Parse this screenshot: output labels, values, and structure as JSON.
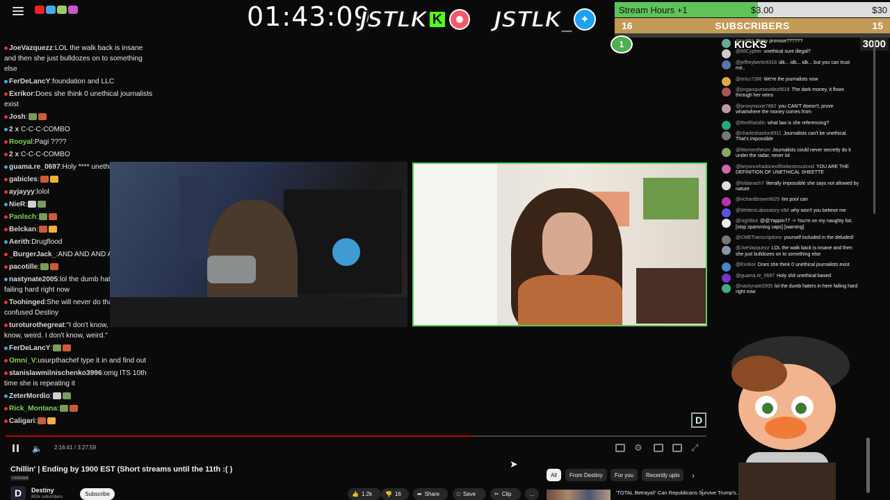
{
  "stream": {
    "timer": "01:43:09",
    "brand_left": "JSTLK",
    "brand_kick": "K",
    "brand_right": "JSTLK_",
    "stream_hours_label": "Stream Hours +1",
    "stream_hours_mid": "$3.00",
    "stream_hours_right": "$30",
    "subs_left": "16",
    "subs_title": "SUBSCRIBERS",
    "subs_right": "15",
    "kicks_badge": "1",
    "kicks_label": "KICKS",
    "kicks_value": "3000",
    "progress_fraction": 0.1,
    "accent": "#58d05a"
  },
  "left_chat": [
    {
      "user": "JoeVazquezz",
      "text": "LOL the walk back is insane and then she just bulldozes on to something else",
      "color": "#d8d8d8"
    },
    {
      "user": "FerDeLancY",
      "text": "foundation and LLC",
      "color": "#d8d8d8"
    },
    {
      "user": "Exrikor",
      "text": "Does she think 0 unethical journalists exist",
      "color": "#d8d8d8"
    },
    {
      "user": "Josh",
      "text": "",
      "color": "#d8d8d8"
    },
    {
      "user": "2 x",
      "text": "C-C-C-COMBO",
      "color": "#d8d8d8"
    },
    {
      "user": "Rooyal",
      "text": "Pagi ????",
      "color": "#7fd35a"
    },
    {
      "user": "2 x",
      "text": "C-C-C-COMBO",
      "color": "#d8d8d8"
    },
    {
      "user": "guama.re_0697",
      "text": "Holy **** unethical based",
      "color": "#d8d8d8"
    },
    {
      "user": "gabicles",
      "text": "",
      "color": "#d8d8d8"
    },
    {
      "user": "ayjayyy",
      "text": "lolol",
      "color": "#d8d8d8"
    },
    {
      "user": "NieR",
      "text": "",
      "color": "#d8d8d8"
    },
    {
      "user": "Panlsch",
      "text": "",
      "color": "#7fd35a"
    },
    {
      "user": "Belckan",
      "text": "",
      "color": "#d8d8d8"
    },
    {
      "user": "Aerith",
      "text": "Drugflood",
      "color": "#d8d8d8"
    },
    {
      "user": "_BurgerJack_",
      "text": "AND AND AND AND AND",
      "color": "#d8d8d8"
    },
    {
      "user": "pacotille",
      "text": "",
      "color": "#d8d8d8"
    },
    {
      "user": "nastynate2005",
      "text": "lol the dumb haters in here failing hard right now",
      "color": "#d8d8d8"
    },
    {
      "user": "Toohinged",
      "text": "She will never do that you're just confused Destiny",
      "color": "#d8d8d8"
    },
    {
      "user": "turoturothegreat",
      "text": "\"I don't know, weird. I don't know, weird. I don't know, weird.\"",
      "color": "#d8d8d8"
    },
    {
      "user": "FerDeLancY",
      "text": "",
      "color": "#d8d8d8"
    },
    {
      "user": "Omni_V",
      "text": "usurpthachef type it in and find out",
      "color": "#7fd35a"
    },
    {
      "user": "stanislawmilnischenko3996",
      "text": "omg ITS 10th time she is repeating it",
      "color": "#d8d8d8"
    },
    {
      "user": "ZeterMordio",
      "text": "",
      "color": "#d8d8d8"
    },
    {
      "user": "Rick_Montana",
      "text": "",
      "color": "#7fd35a"
    },
    {
      "user": "Caligari",
      "text": "",
      "color": "#d8d8d8"
    }
  ],
  "player": {
    "time": "2:16:41 / 3:27:59",
    "logo": "D"
  },
  "video": {
    "title": "Chillin' | Ending by 1900 EST (Short streams until the 11th :( )",
    "visibility": "Unlisted",
    "channel": "Destiny",
    "subs": "861k subscribers",
    "subscribe": "Subscribe",
    "likes": "1.2k",
    "dislikes": "16",
    "share": "Share",
    "save": "Save",
    "clip": "Clip",
    "more": "…"
  },
  "chips": [
    "All",
    "From Destiny",
    "For you",
    "Recently uplo"
  ],
  "recommended": {
    "title": "'TOTAL Betrayal!' Can Republicans Survive Trump's..."
  },
  "right_chat": [
    {
      "user": "@ov959",
      "text": "Pinky promise??????",
      "color": "#6a9"
    },
    {
      "user": "@68Cypher",
      "text": "unethical sure illegal?",
      "color": "#ccc"
    },
    {
      "user": "@jeffreybertin9318",
      "text": "idk... idk... idk... but you can trust me..",
      "color": "#57a"
    },
    {
      "user": "@ericc7286",
      "text": "We're the journalists now",
      "color": "#da4"
    },
    {
      "user": "@jorganquesavidez6618",
      "text": "The dark money, it flows through her veins",
      "color": "#a55"
    },
    {
      "user": "@proxymoxie7882",
      "text": "you CAN'T doesn't, prove what/where the money comes from",
      "color": "#b9a"
    },
    {
      "user": "@RedRaistlin",
      "text": "what law is she referencing?",
      "color": "#2a7"
    },
    {
      "user": "@charleshanlon8911",
      "text": "Journalists can't be unethical. That's impossible",
      "color": "#777"
    },
    {
      "user": "@Momentheum",
      "text": "Journalists could never secretly do it under the radar, never lol",
      "color": "#8a6"
    },
    {
      "user": "@beyoncehadoneofthebestmusicvid",
      "text": "YOU ARE THE DEFINITION OF UNETHICAL SHEETTE",
      "color": "#c6a"
    },
    {
      "user": "@loldanach7",
      "text": "literally impossible she says not allowed by nature",
      "color": "#ddd"
    },
    {
      "user": "@richardbrown9025",
      "text": "tim pool can",
      "color": "#b3a"
    },
    {
      "user": "@WritersLaboratory-s9d",
      "text": "why won't you believe me",
      "color": "#55d"
    },
    {
      "user": "@nightbot",
      "text": "@@Yappin77 -> You're on my naughty list. [stop spamming caps] [warning]",
      "color": "#eee"
    },
    {
      "user": "@CMETranscriptions",
      "text": "yourself included in the deluded!",
      "color": "#777"
    },
    {
      "user": "@JoeVazquezz",
      "text": "LOL the walk back is insane and then she just bulldozes on to something else",
      "color": "#89a"
    },
    {
      "user": "@Exrikor",
      "text": "Does she think 0 unethical journalists exist",
      "color": "#48c"
    },
    {
      "user": "@guama.re_0697",
      "text": "Holy shit unethical based",
      "color": "#73c"
    },
    {
      "user": "@nastynate2005",
      "text": "lol the dumb haters in here failing hard right now",
      "color": "#4a8"
    }
  ]
}
